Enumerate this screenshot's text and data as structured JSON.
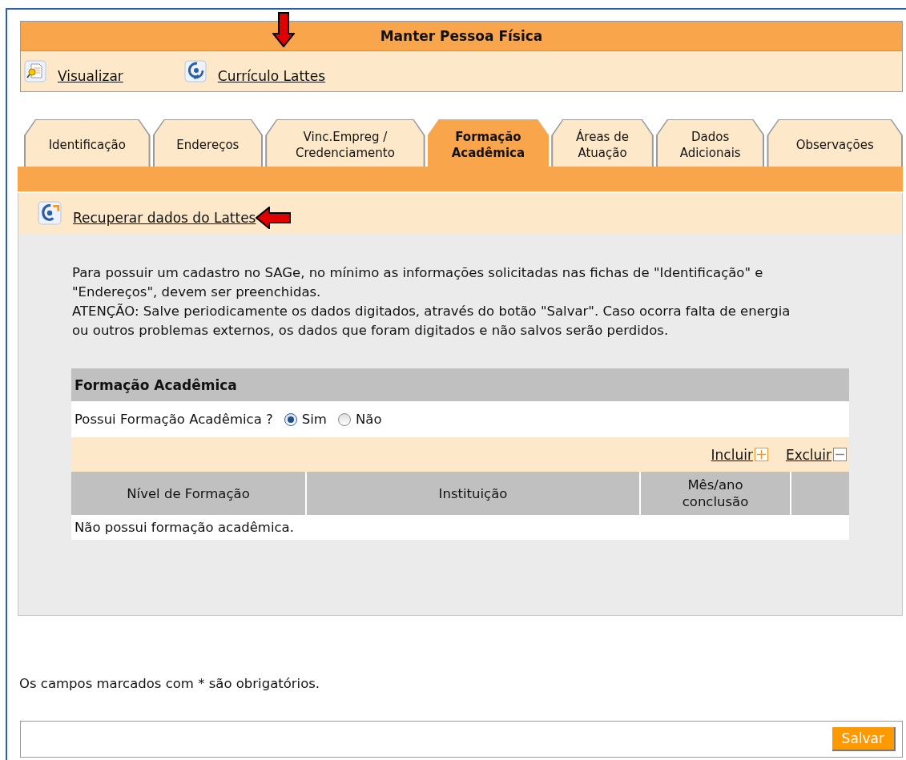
{
  "page_title": "Manter Pessoa Física",
  "toolbar": [
    {
      "label": "Visualizar",
      "kind": "view",
      "marked": false
    },
    {
      "label": "Currículo Lattes",
      "kind": "lattes",
      "marked": true
    }
  ],
  "tabs": [
    {
      "label": "Identificação",
      "selected": false
    },
    {
      "label": "Endereços",
      "selected": false
    },
    {
      "label": "Vinc.Empreg /\nCredenciamento",
      "selected": false
    },
    {
      "label": "Formação\nAcadêmica",
      "selected": true
    },
    {
      "label": "Áreas de\nAtuação",
      "selected": false
    },
    {
      "label": "Dados\nAdicionais",
      "selected": false
    },
    {
      "label": "Observações",
      "selected": false
    }
  ],
  "lattes_link": {
    "label": "Recuperar dados do Lattes",
    "marked": true
  },
  "notice": [
    "Para possuir um cadastro no SAGe, no mínimo as informações solicitadas nas fichas de \"Identificação\" e \"Endereços\", devem ser preenchidas.",
    "ATENÇÃO: Salve periodicamente os dados digitados, através do botão \"Salvar\". Caso ocorra falta de energia ou outros problemas externos, os dados que foram digitados e não salvos serão perdidos."
  ],
  "section": {
    "title": "Formação Acadêmica",
    "question": "Possui Formação Acadêmica ?",
    "options": [
      {
        "label": "Sim",
        "selected": true
      },
      {
        "label": "Não",
        "selected": false
      }
    ],
    "actions": [
      {
        "label": "Incluir",
        "kind": "add"
      },
      {
        "label": "Excluir",
        "kind": "remove"
      }
    ],
    "columns": [
      "Nível de Formação",
      "Instituição",
      "Mês/ano\nconclusão"
    ],
    "empty_message": "Não possui formação acadêmica."
  },
  "footer_note": "Os campos marcados com * são obrigatórios.",
  "save_button": "Salvar"
}
